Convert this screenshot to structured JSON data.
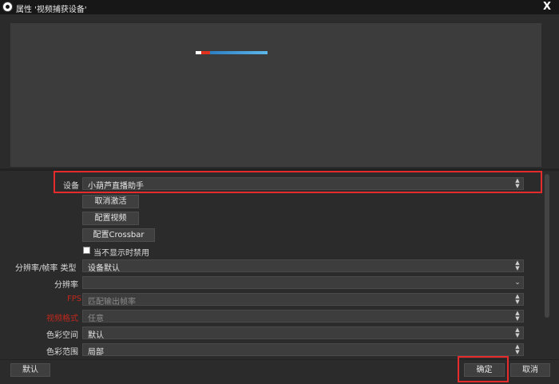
{
  "window": {
    "title": "属性 '视频捕获设备'",
    "close_label": "X",
    "icon": "obs-logo-icon"
  },
  "preview": {
    "description_colors": {
      "background": "#3c3c3c"
    }
  },
  "properties": {
    "device": {
      "label": "设备",
      "value": "小葫芦直播助手"
    },
    "deactivate_button": "取消激活",
    "config_video_button": "配置视频",
    "config_crossbar_button": "配置Crossbar",
    "hide_when_inactive": {
      "label": "当不显示时禁用",
      "checked": true
    },
    "resolution_fps_type": {
      "label": "分辨率/帧率 类型",
      "value": "设备默认"
    },
    "resolution": {
      "label": "分辨率",
      "value": ""
    },
    "fps": {
      "label": "FPS",
      "value": "匹配输出帧率"
    },
    "video_format": {
      "label": "视频格式",
      "value": "任意"
    },
    "color_space": {
      "label": "色彩空间",
      "value": "默认"
    },
    "color_range": {
      "label": "色彩范围",
      "value": "局部"
    }
  },
  "footer": {
    "defaults_button": "默认",
    "ok_button": "确定",
    "cancel_button": "取消"
  },
  "colors": {
    "highlight": "#e52b2b",
    "disabled_label": "#c0281e",
    "background": "#2b2b2b"
  }
}
